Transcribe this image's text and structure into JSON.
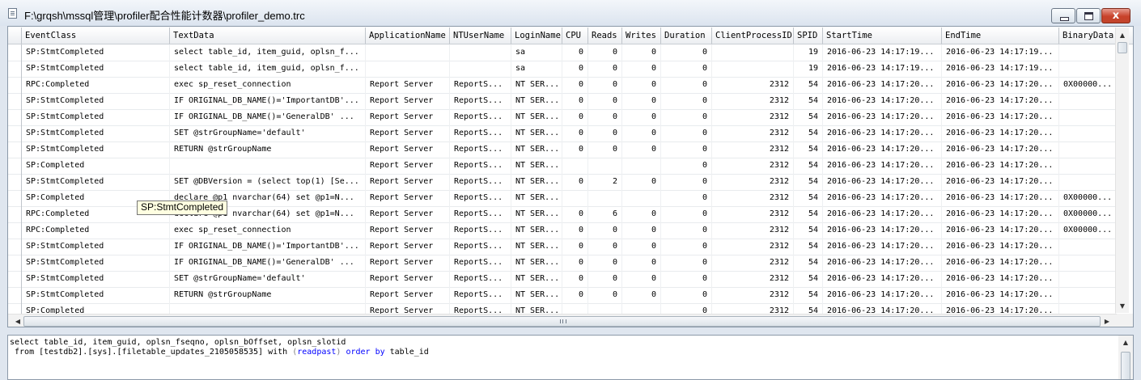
{
  "window": {
    "title": "F:\\grqsh\\mssql管理\\profiler配合性能计数器\\profiler_demo.trc",
    "close_glyph": "x"
  },
  "grid": {
    "columns": [
      {
        "label": "EventClass",
        "align": "l"
      },
      {
        "label": "TextData",
        "align": "l"
      },
      {
        "label": "ApplicationName",
        "align": "l"
      },
      {
        "label": "NTUserName",
        "align": "l"
      },
      {
        "label": "LoginName",
        "align": "l"
      },
      {
        "label": "CPU",
        "align": "r"
      },
      {
        "label": "Reads",
        "align": "r"
      },
      {
        "label": "Writes",
        "align": "r"
      },
      {
        "label": "Duration",
        "align": "r"
      },
      {
        "label": "ClientProcessID",
        "align": "r"
      },
      {
        "label": "SPID",
        "align": "r"
      },
      {
        "label": "StartTime",
        "align": "l"
      },
      {
        "label": "EndTime",
        "align": "l"
      },
      {
        "label": "BinaryData",
        "align": "l"
      }
    ],
    "rows": [
      [
        "SP:StmtCompleted",
        "select table_id, item_guid, oplsn_f...",
        "",
        "",
        "sa",
        "0",
        "0",
        "0",
        "0",
        "",
        "19",
        "2016-06-23 14:17:19...",
        "2016-06-23 14:17:19...",
        ""
      ],
      [
        "SP:StmtCompleted",
        "select table_id, item_guid, oplsn_f...",
        "",
        "",
        "sa",
        "0",
        "0",
        "0",
        "0",
        "",
        "19",
        "2016-06-23 14:17:19...",
        "2016-06-23 14:17:19...",
        ""
      ],
      [
        "RPC:Completed",
        "exec sp_reset_connection",
        "Report Server",
        "ReportS...",
        "NT SER...",
        "0",
        "0",
        "0",
        "0",
        "2312",
        "54",
        "2016-06-23 14:17:20...",
        "2016-06-23 14:17:20...",
        "0X00000..."
      ],
      [
        "SP:StmtCompleted",
        "IF ORIGINAL_DB_NAME()='ImportantDB'...",
        "Report Server",
        "ReportS...",
        "NT SER...",
        "0",
        "0",
        "0",
        "0",
        "2312",
        "54",
        "2016-06-23 14:17:20...",
        "2016-06-23 14:17:20...",
        ""
      ],
      [
        "SP:StmtCompleted",
        "IF ORIGINAL_DB_NAME()='GeneralDB'   ...",
        "Report Server",
        "ReportS...",
        "NT SER...",
        "0",
        "0",
        "0",
        "0",
        "2312",
        "54",
        "2016-06-23 14:17:20...",
        "2016-06-23 14:17:20...",
        ""
      ],
      [
        "SP:StmtCompleted",
        "SET @strGroupName='default'",
        "Report Server",
        "ReportS...",
        "NT SER...",
        "0",
        "0",
        "0",
        "0",
        "2312",
        "54",
        "2016-06-23 14:17:20...",
        "2016-06-23 14:17:20...",
        ""
      ],
      [
        "SP:StmtCompleted",
        "RETURN @strGroupName",
        "Report Server",
        "ReportS...",
        "NT SER...",
        "0",
        "0",
        "0",
        "0",
        "2312",
        "54",
        "2016-06-23 14:17:20...",
        "2016-06-23 14:17:20...",
        ""
      ],
      [
        "SP:Completed",
        "",
        "Report Server",
        "ReportS...",
        "NT SER...",
        "",
        "",
        "",
        "0",
        "2312",
        "54",
        "2016-06-23 14:17:20...",
        "2016-06-23 14:17:20...",
        ""
      ],
      [
        "SP:StmtCompleted",
        "SET @DBVersion = (select top(1) [Se...",
        "Report Server",
        "ReportS...",
        "NT SER...",
        "0",
        "2",
        "0",
        "0",
        "2312",
        "54",
        "2016-06-23 14:17:20...",
        "2016-06-23 14:17:20...",
        ""
      ],
      [
        "SP:Completed",
        "declare @p1 nvarchar(64)  set @p1=N...",
        "Report Server",
        "ReportS...",
        "NT SER...",
        "",
        "",
        "",
        "0",
        "2312",
        "54",
        "2016-06-23 14:17:20...",
        "2016-06-23 14:17:20...",
        "0X00000..."
      ],
      [
        "RPC:Completed",
        "declare @p1 nvarchar(64)  set @p1=N...",
        "Report Server",
        "ReportS...",
        "NT SER...",
        "0",
        "6",
        "0",
        "0",
        "2312",
        "54",
        "2016-06-23 14:17:20...",
        "2016-06-23 14:17:20...",
        "0X00000..."
      ],
      [
        "RPC:Completed",
        "exec sp_reset_connection",
        "Report Server",
        "ReportS...",
        "NT SER...",
        "0",
        "0",
        "0",
        "0",
        "2312",
        "54",
        "2016-06-23 14:17:20...",
        "2016-06-23 14:17:20...",
        "0X00000..."
      ],
      [
        "SP:StmtCompleted",
        "IF ORIGINAL_DB_NAME()='ImportantDB'...",
        "Report Server",
        "ReportS...",
        "NT SER...",
        "0",
        "0",
        "0",
        "0",
        "2312",
        "54",
        "2016-06-23 14:17:20...",
        "2016-06-23 14:17:20...",
        ""
      ],
      [
        "SP:StmtCompleted",
        "IF ORIGINAL_DB_NAME()='GeneralDB'   ...",
        "Report Server",
        "ReportS...",
        "NT SER...",
        "0",
        "0",
        "0",
        "0",
        "2312",
        "54",
        "2016-06-23 14:17:20...",
        "2016-06-23 14:17:20...",
        ""
      ],
      [
        "SP:StmtCompleted",
        "SET @strGroupName='default'",
        "Report Server",
        "ReportS...",
        "NT SER...",
        "0",
        "0",
        "0",
        "0",
        "2312",
        "54",
        "2016-06-23 14:17:20...",
        "2016-06-23 14:17:20...",
        ""
      ],
      [
        "SP:StmtCompleted",
        "RETURN @strGroupName",
        "Report Server",
        "ReportS...",
        "NT SER...",
        "0",
        "0",
        "0",
        "0",
        "2312",
        "54",
        "2016-06-23 14:17:20...",
        "2016-06-23 14:17:20...",
        ""
      ],
      [
        "SP:Completed",
        "",
        "Report Server",
        "ReportS...",
        "NT SER...",
        "",
        "",
        "",
        "0",
        "2312",
        "54",
        "2016-06-23 14:17:20...",
        "2016-06-23 14:17:20...",
        ""
      ]
    ]
  },
  "tooltip": {
    "text": "SP:StmtCompleted"
  },
  "text_pane": {
    "line1": "select table_id, item_guid, oplsn_fseqno, oplsn_bOffset, oplsn_slotid",
    "line2": {
      "part1": " from [testdb2].[sys].[filetable_updates_2105058535] with ",
      "paren_open": "(",
      "kw_readpast": "readpast",
      "paren_close": ")",
      "kw_order": " order",
      "kw_by": " by",
      "part_end": " table_id"
    }
  },
  "colors": {
    "keyword": "#0000ff",
    "tooltip_bg": "#ffffe1"
  }
}
